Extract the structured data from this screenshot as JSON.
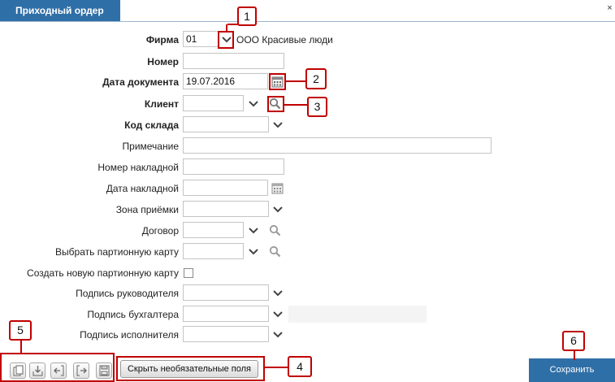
{
  "header": {
    "title": "Приходный ордер",
    "close_label": "×"
  },
  "form": {
    "firma": {
      "label": "Фирма",
      "value": "01",
      "company": "ООО Красивые люди"
    },
    "nomer": {
      "label": "Номер",
      "value": ""
    },
    "data_dokumenta": {
      "label": "Дата документа",
      "value": "19.07.2016"
    },
    "klient": {
      "label": "Клиент",
      "value": ""
    },
    "kod_sklada": {
      "label": "Код склада",
      "value": ""
    },
    "primechanie": {
      "label": "Примечание",
      "value": ""
    },
    "nomer_nakladnoy": {
      "label": "Номер накладной",
      "value": ""
    },
    "data_nakladnoy": {
      "label": "Дата накладной",
      "value": ""
    },
    "zona_priemki": {
      "label": "Зона приёмки",
      "value": ""
    },
    "dogovor": {
      "label": "Договор",
      "value": ""
    },
    "partionnaya_karta": {
      "label": "Выбрать партионную карту",
      "value": ""
    },
    "new_partionnaya": {
      "label": "Создать новую партионную карту",
      "checked": false
    },
    "podpis_rukovoditelya": {
      "label": "Подпись руководителя",
      "value": ""
    },
    "podpis_buhgaltera": {
      "label": "Подпись бухгалтера",
      "value": ""
    },
    "podpis_ispolnitelya": {
      "label": "Подпись исполнителя",
      "value": ""
    }
  },
  "footer": {
    "hide_fields_label": "Скрыть необязательные поля",
    "save_label": "Сохранить",
    "toolbar_icons": [
      "copy-icon",
      "import-icon",
      "back-icon",
      "forward-icon",
      "save-icon"
    ]
  },
  "callouts": [
    "1",
    "2",
    "3",
    "4",
    "5",
    "6"
  ],
  "colors": {
    "header_bg": "#2f6fa7",
    "callout_border": "#c00000",
    "save_bg": "#2f6fa7"
  }
}
